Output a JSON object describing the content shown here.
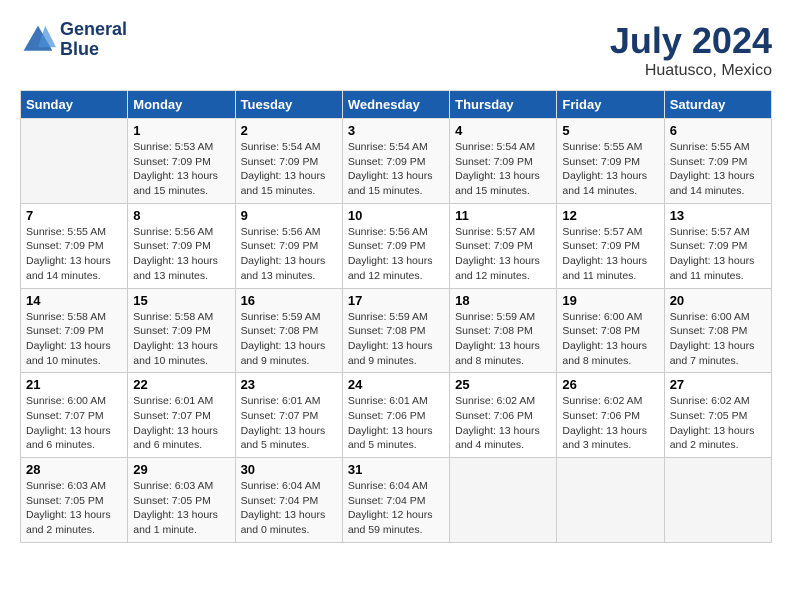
{
  "header": {
    "logo_line1": "General",
    "logo_line2": "Blue",
    "month": "July 2024",
    "location": "Huatusco, Mexico"
  },
  "columns": [
    "Sunday",
    "Monday",
    "Tuesday",
    "Wednesday",
    "Thursday",
    "Friday",
    "Saturday"
  ],
  "weeks": [
    [
      {
        "day": "",
        "info": ""
      },
      {
        "day": "1",
        "info": "Sunrise: 5:53 AM\nSunset: 7:09 PM\nDaylight: 13 hours\nand 15 minutes."
      },
      {
        "day": "2",
        "info": "Sunrise: 5:54 AM\nSunset: 7:09 PM\nDaylight: 13 hours\nand 15 minutes."
      },
      {
        "day": "3",
        "info": "Sunrise: 5:54 AM\nSunset: 7:09 PM\nDaylight: 13 hours\nand 15 minutes."
      },
      {
        "day": "4",
        "info": "Sunrise: 5:54 AM\nSunset: 7:09 PM\nDaylight: 13 hours\nand 15 minutes."
      },
      {
        "day": "5",
        "info": "Sunrise: 5:55 AM\nSunset: 7:09 PM\nDaylight: 13 hours\nand 14 minutes."
      },
      {
        "day": "6",
        "info": "Sunrise: 5:55 AM\nSunset: 7:09 PM\nDaylight: 13 hours\nand 14 minutes."
      }
    ],
    [
      {
        "day": "7",
        "info": "Sunrise: 5:55 AM\nSunset: 7:09 PM\nDaylight: 13 hours\nand 14 minutes."
      },
      {
        "day": "8",
        "info": "Sunrise: 5:56 AM\nSunset: 7:09 PM\nDaylight: 13 hours\nand 13 minutes."
      },
      {
        "day": "9",
        "info": "Sunrise: 5:56 AM\nSunset: 7:09 PM\nDaylight: 13 hours\nand 13 minutes."
      },
      {
        "day": "10",
        "info": "Sunrise: 5:56 AM\nSunset: 7:09 PM\nDaylight: 13 hours\nand 12 minutes."
      },
      {
        "day": "11",
        "info": "Sunrise: 5:57 AM\nSunset: 7:09 PM\nDaylight: 13 hours\nand 12 minutes."
      },
      {
        "day": "12",
        "info": "Sunrise: 5:57 AM\nSunset: 7:09 PM\nDaylight: 13 hours\nand 11 minutes."
      },
      {
        "day": "13",
        "info": "Sunrise: 5:57 AM\nSunset: 7:09 PM\nDaylight: 13 hours\nand 11 minutes."
      }
    ],
    [
      {
        "day": "14",
        "info": "Sunrise: 5:58 AM\nSunset: 7:09 PM\nDaylight: 13 hours\nand 10 minutes."
      },
      {
        "day": "15",
        "info": "Sunrise: 5:58 AM\nSunset: 7:09 PM\nDaylight: 13 hours\nand 10 minutes."
      },
      {
        "day": "16",
        "info": "Sunrise: 5:59 AM\nSunset: 7:08 PM\nDaylight: 13 hours\nand 9 minutes."
      },
      {
        "day": "17",
        "info": "Sunrise: 5:59 AM\nSunset: 7:08 PM\nDaylight: 13 hours\nand 9 minutes."
      },
      {
        "day": "18",
        "info": "Sunrise: 5:59 AM\nSunset: 7:08 PM\nDaylight: 13 hours\nand 8 minutes."
      },
      {
        "day": "19",
        "info": "Sunrise: 6:00 AM\nSunset: 7:08 PM\nDaylight: 13 hours\nand 8 minutes."
      },
      {
        "day": "20",
        "info": "Sunrise: 6:00 AM\nSunset: 7:08 PM\nDaylight: 13 hours\nand 7 minutes."
      }
    ],
    [
      {
        "day": "21",
        "info": "Sunrise: 6:00 AM\nSunset: 7:07 PM\nDaylight: 13 hours\nand 6 minutes."
      },
      {
        "day": "22",
        "info": "Sunrise: 6:01 AM\nSunset: 7:07 PM\nDaylight: 13 hours\nand 6 minutes."
      },
      {
        "day": "23",
        "info": "Sunrise: 6:01 AM\nSunset: 7:07 PM\nDaylight: 13 hours\nand 5 minutes."
      },
      {
        "day": "24",
        "info": "Sunrise: 6:01 AM\nSunset: 7:06 PM\nDaylight: 13 hours\nand 5 minutes."
      },
      {
        "day": "25",
        "info": "Sunrise: 6:02 AM\nSunset: 7:06 PM\nDaylight: 13 hours\nand 4 minutes."
      },
      {
        "day": "26",
        "info": "Sunrise: 6:02 AM\nSunset: 7:06 PM\nDaylight: 13 hours\nand 3 minutes."
      },
      {
        "day": "27",
        "info": "Sunrise: 6:02 AM\nSunset: 7:05 PM\nDaylight: 13 hours\nand 2 minutes."
      }
    ],
    [
      {
        "day": "28",
        "info": "Sunrise: 6:03 AM\nSunset: 7:05 PM\nDaylight: 13 hours\nand 2 minutes."
      },
      {
        "day": "29",
        "info": "Sunrise: 6:03 AM\nSunset: 7:05 PM\nDaylight: 13 hours\nand 1 minute."
      },
      {
        "day": "30",
        "info": "Sunrise: 6:04 AM\nSunset: 7:04 PM\nDaylight: 13 hours\nand 0 minutes."
      },
      {
        "day": "31",
        "info": "Sunrise: 6:04 AM\nSunset: 7:04 PM\nDaylight: 12 hours\nand 59 minutes."
      },
      {
        "day": "",
        "info": ""
      },
      {
        "day": "",
        "info": ""
      },
      {
        "day": "",
        "info": ""
      }
    ]
  ]
}
